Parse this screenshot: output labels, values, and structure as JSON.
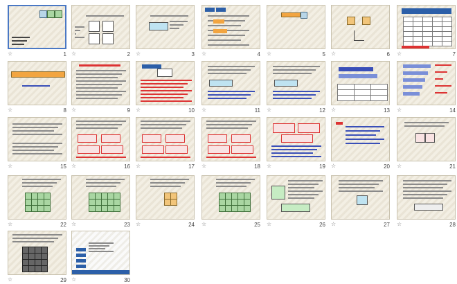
{
  "slides": [
    {
      "n": "1",
      "title": "表面积的变化"
    },
    {
      "n": "2",
      "tag": "复习准备"
    },
    {
      "n": "3",
      "tag": "复习准备"
    },
    {
      "n": "4"
    },
    {
      "n": "5"
    },
    {
      "n": "6"
    },
    {
      "n": "7"
    },
    {
      "n": "8"
    },
    {
      "n": "9"
    },
    {
      "n": "10"
    },
    {
      "n": "11"
    },
    {
      "n": "12"
    },
    {
      "n": "13"
    },
    {
      "n": "14"
    },
    {
      "n": "15"
    },
    {
      "n": "16"
    },
    {
      "n": "17"
    },
    {
      "n": "18"
    },
    {
      "n": "19"
    },
    {
      "n": "20"
    },
    {
      "n": "21"
    },
    {
      "n": "22"
    },
    {
      "n": "23"
    },
    {
      "n": "24"
    },
    {
      "n": "25"
    },
    {
      "n": "26"
    },
    {
      "n": "27"
    },
    {
      "n": "28"
    },
    {
      "n": "29"
    },
    {
      "n": "30",
      "brand": "第1PPT"
    }
  ],
  "colors": {
    "accent": "#2c5fa8",
    "selection": "#4a78c4",
    "red": "#dd3333"
  }
}
